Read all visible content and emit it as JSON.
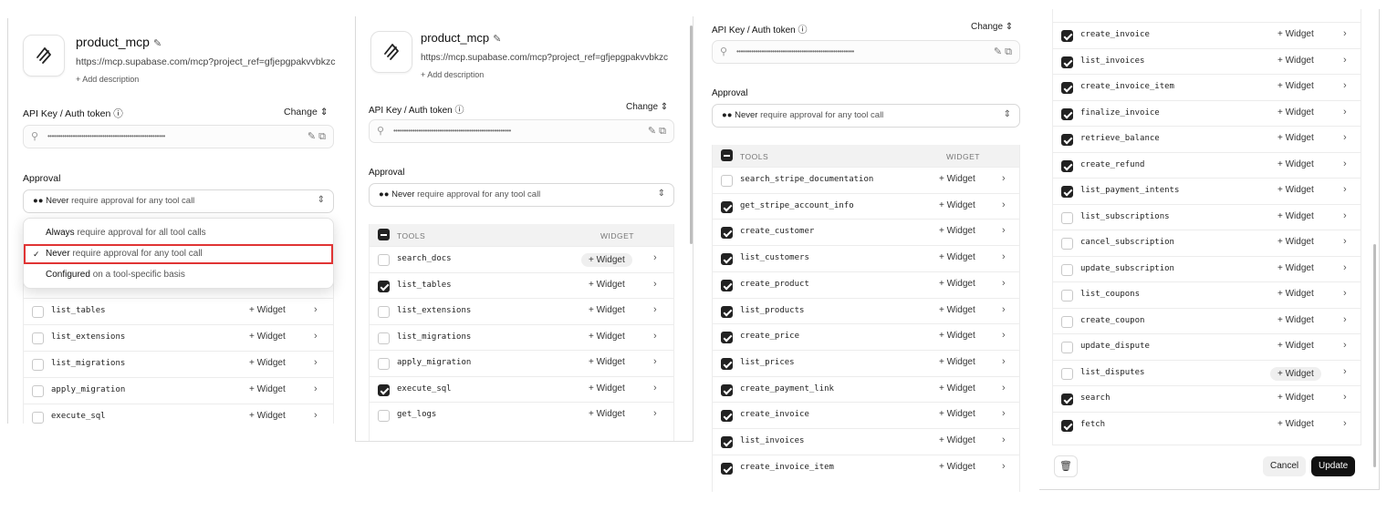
{
  "server": {
    "name": "product_mcp",
    "url": "https://mcp.supabase.com/mcp?project_ref=gfjepgpakvvbkzc",
    "add_description": "+ Add description"
  },
  "auth": {
    "label": "API Key / Auth token",
    "info_icon": "ⓘ",
    "change": "Change",
    "masked": "••••••••••••••••••••••••••••••••••••••••••••••••••••••••"
  },
  "approval": {
    "label": "Approval",
    "selected_prefix": "Never",
    "selected_rest": " require approval for any tool call",
    "options": [
      {
        "bold": "Always",
        "rest": " require approval for all tool calls",
        "selected": false
      },
      {
        "bold": "Never",
        "rest": " require approval for any tool call",
        "selected": true
      },
      {
        "bold": "Configured",
        "rest": " on a tool-specific basis",
        "selected": false
      }
    ]
  },
  "table": {
    "tools_header": "TOOLS",
    "widget_header": "WIDGET",
    "widget_label": "+ Widget"
  },
  "panel1_tools": [
    {
      "name": "list_tables",
      "checked": false
    },
    {
      "name": "list_extensions",
      "checked": false
    },
    {
      "name": "list_migrations",
      "checked": false
    },
    {
      "name": "apply_migration",
      "checked": false
    },
    {
      "name": "execute_sql",
      "checked": false
    }
  ],
  "panel2_tools": [
    {
      "name": "search_docs",
      "checked": false,
      "highlight": true
    },
    {
      "name": "list_tables",
      "checked": true
    },
    {
      "name": "list_extensions",
      "checked": false
    },
    {
      "name": "list_migrations",
      "checked": false
    },
    {
      "name": "apply_migration",
      "checked": false
    },
    {
      "name": "execute_sql",
      "checked": true
    },
    {
      "name": "get_logs",
      "checked": false
    }
  ],
  "panel3_tools": [
    {
      "name": "search_stripe_documentation",
      "checked": false
    },
    {
      "name": "get_stripe_account_info",
      "checked": true
    },
    {
      "name": "create_customer",
      "checked": true
    },
    {
      "name": "list_customers",
      "checked": true
    },
    {
      "name": "create_product",
      "checked": true
    },
    {
      "name": "list_products",
      "checked": true
    },
    {
      "name": "create_price",
      "checked": true
    },
    {
      "name": "list_prices",
      "checked": true
    },
    {
      "name": "create_payment_link",
      "checked": true
    },
    {
      "name": "create_invoice",
      "checked": true
    },
    {
      "name": "list_invoices",
      "checked": true
    },
    {
      "name": "create_invoice_item",
      "checked": true
    }
  ],
  "panel4_tools": [
    {
      "name": "create_invoice",
      "checked": true
    },
    {
      "name": "list_invoices",
      "checked": true
    },
    {
      "name": "create_invoice_item",
      "checked": true
    },
    {
      "name": "finalize_invoice",
      "checked": true
    },
    {
      "name": "retrieve_balance",
      "checked": true
    },
    {
      "name": "create_refund",
      "checked": true
    },
    {
      "name": "list_payment_intents",
      "checked": true
    },
    {
      "name": "list_subscriptions",
      "checked": false
    },
    {
      "name": "cancel_subscription",
      "checked": false
    },
    {
      "name": "update_subscription",
      "checked": false
    },
    {
      "name": "list_coupons",
      "checked": false
    },
    {
      "name": "create_coupon",
      "checked": false
    },
    {
      "name": "update_dispute",
      "checked": false
    },
    {
      "name": "list_disputes",
      "checked": false,
      "highlight": true
    },
    {
      "name": "search",
      "checked": true
    },
    {
      "name": "fetch",
      "checked": true
    }
  ],
  "footer": {
    "cancel": "Cancel",
    "update": "Update"
  }
}
